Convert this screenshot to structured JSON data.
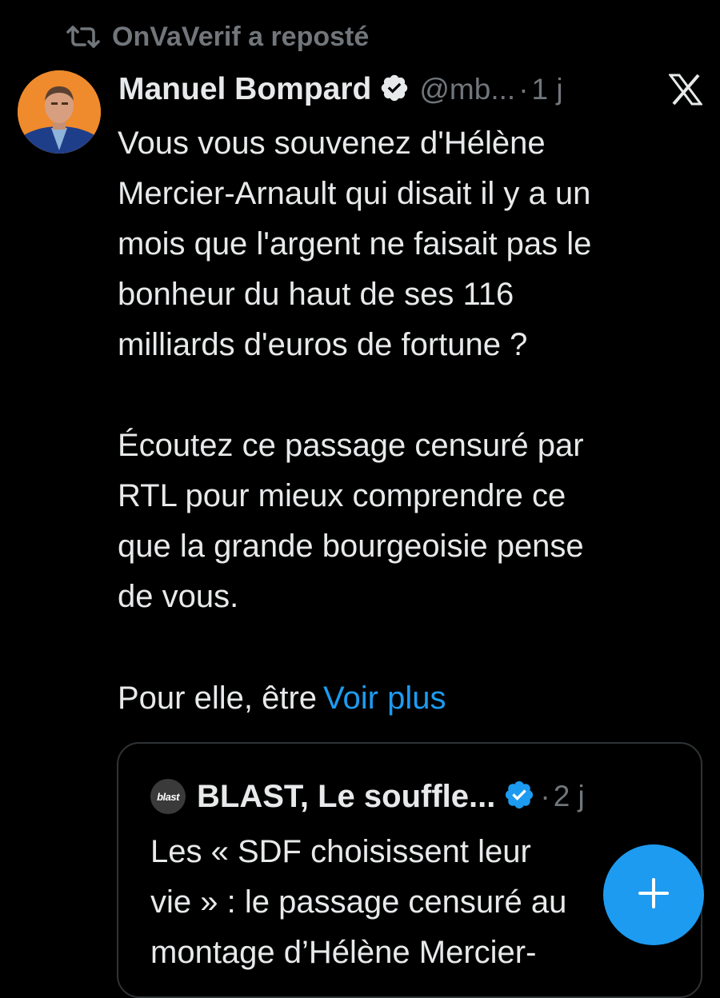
{
  "repost": {
    "icon": "repost-icon",
    "text": "OnVaVerif a reposté"
  },
  "tweet": {
    "author": {
      "name": "Manuel Bompard",
      "handle": "@mb...",
      "verified": true,
      "avatar_bg": "#ef8a2d"
    },
    "separator": "·",
    "age": "1 j",
    "text": "Vous vous souvenez d'Hélène\nMercier-Arnault qui disait il y a un\nmois que l'argent ne faisait pas le\nbonheur du haut de ses 116\nmilliards d'euros de fortune ?\n\nÉcoutez ce passage censuré par\nRTL pour mieux comprendre ce\nque la grande bourgeoisie pense\nde vous.",
    "truncated_lead": "Pour elle, être",
    "see_more": "Voir plus"
  },
  "quote": {
    "avatar_text": "blast",
    "author": "BLAST, Le souffle...",
    "verified": true,
    "separator": "·",
    "age": "2 j",
    "text": "Les « SDF choisissent leur\nvie » : le passage censuré au\nmontage d’Hélène Mercier-"
  },
  "colors": {
    "background": "#000000",
    "text_primary": "#e7e9ea",
    "text_secondary": "#71767b",
    "accent": "#1d9bf0",
    "border": "#2f3336"
  },
  "icons": {
    "x_logo": "x-logo-icon",
    "verified": "verified-badge-icon",
    "compose": "plus-icon"
  }
}
